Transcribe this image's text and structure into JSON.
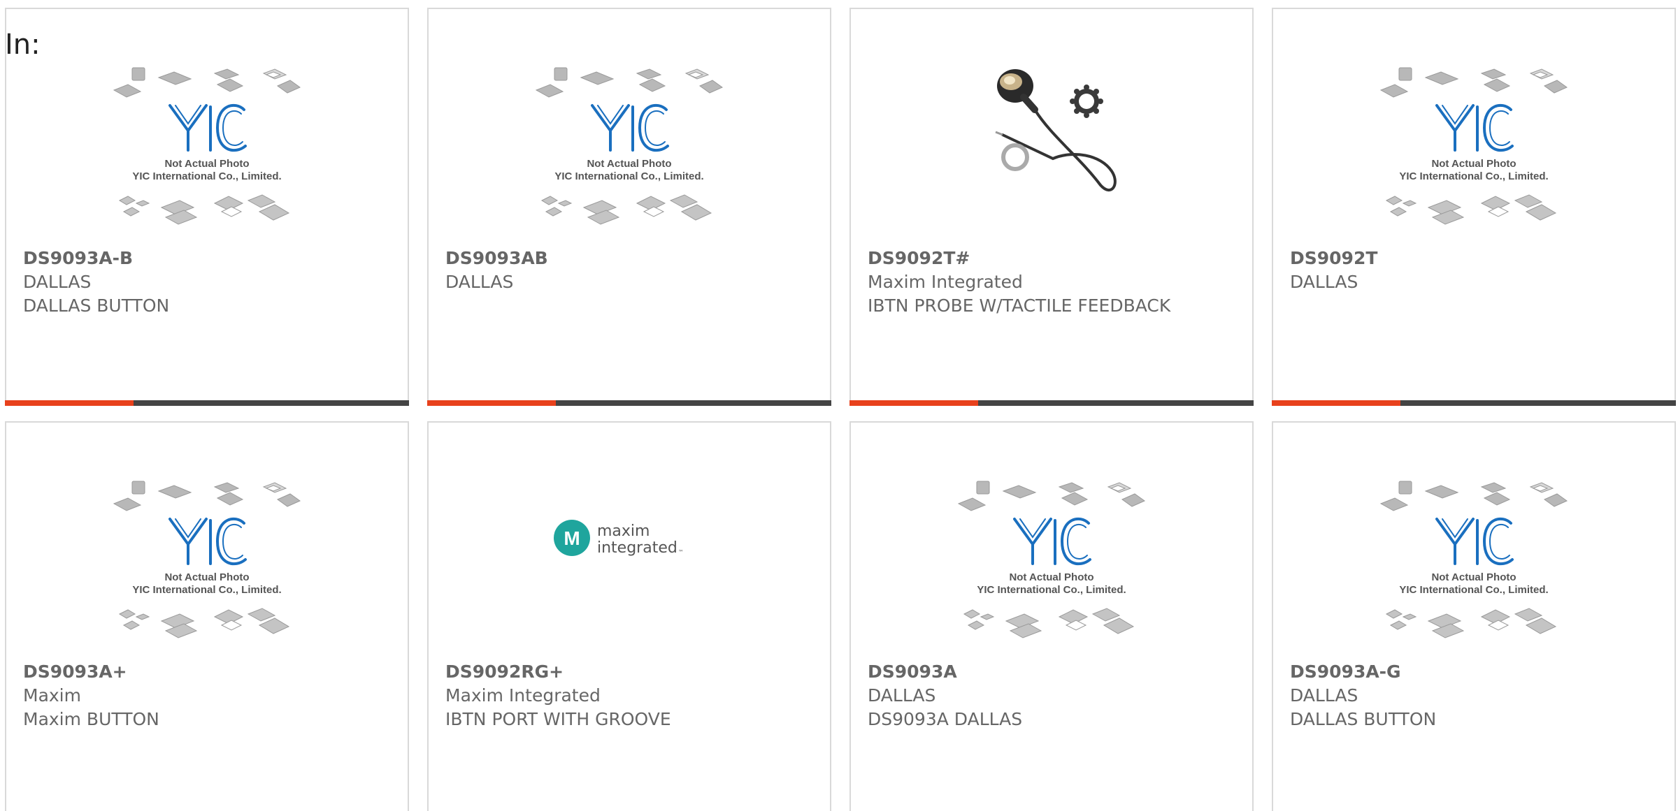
{
  "header": {
    "label": "In:"
  },
  "colors": {
    "accent": "#e8411c",
    "bar": "#444444",
    "border": "#d9d9d9",
    "text": "#666666"
  },
  "placeholder": {
    "line1": "Not Actual Photo",
    "line2": "YIC International Co., Limited."
  },
  "maxim_logo": {
    "line1": "maxim",
    "line2": "integrated",
    "tm": "™"
  },
  "products": [
    {
      "pn": "DS9093A-B",
      "mfr": "DALLAS",
      "desc": "DALLAS BUTTON",
      "image": "yic-placeholder"
    },
    {
      "pn": "DS9093AB",
      "mfr": "DALLAS",
      "desc": "",
      "image": "yic-placeholder"
    },
    {
      "pn": "DS9092T#",
      "mfr": "Maxim Integrated",
      "desc": "IBTN PROBE W/TACTILE FEEDBACK",
      "image": "probe-photo"
    },
    {
      "pn": "DS9092T",
      "mfr": "DALLAS",
      "desc": "",
      "image": "yic-placeholder"
    },
    {
      "pn": "DS9093A+",
      "mfr": "Maxim",
      "desc": "Maxim BUTTON",
      "image": "yic-placeholder"
    },
    {
      "pn": "DS9092RG+",
      "mfr": "Maxim Integrated",
      "desc": "IBTN PORT WITH GROOVE",
      "image": "maxim-logo"
    },
    {
      "pn": "DS9093A",
      "mfr": "DALLAS",
      "desc": "DS9093A DALLAS",
      "image": "yic-placeholder"
    },
    {
      "pn": "DS9093A-G",
      "mfr": "DALLAS",
      "desc": "DALLAS BUTTON",
      "image": "yic-placeholder"
    }
  ]
}
